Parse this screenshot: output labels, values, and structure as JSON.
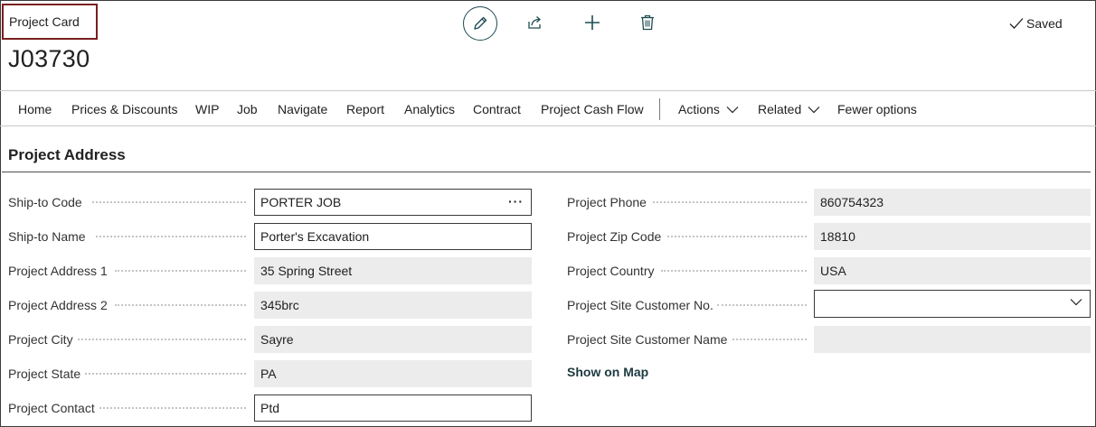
{
  "page": {
    "title": "Project Card",
    "record_no": "J03730",
    "status": "Saved"
  },
  "toolbar": {
    "edit_icon": "pencil-icon",
    "share_icon": "share-icon",
    "new_icon": "plus-icon",
    "delete_icon": "trash-icon"
  },
  "action_bar": {
    "items": [
      "Home",
      "Prices & Discounts",
      "WIP",
      "Job",
      "Navigate",
      "Report",
      "Analytics",
      "Contract",
      "Project Cash Flow"
    ],
    "actions": "Actions",
    "related": "Related",
    "fewer_options": "Fewer options"
  },
  "section": {
    "title": "Project Address"
  },
  "fields_left": [
    {
      "label": "Ship-to Code",
      "value": "PORTER JOB",
      "editable": true
    },
    {
      "label": "Ship-to Name",
      "value": "Porter's Excavation",
      "editable": true
    },
    {
      "label": "Project  Address 1",
      "value": "35 Spring Street",
      "editable": false
    },
    {
      "label": "Project  Address 2",
      "value": "345brc",
      "editable": false
    },
    {
      "label": "Project City",
      "value": "Sayre",
      "editable": false
    },
    {
      "label": "Project State",
      "value": "PA",
      "editable": false
    },
    {
      "label": "Project Contact",
      "value": "Ptd",
      "editable": true
    }
  ],
  "fields_right": [
    {
      "label": "Project Phone",
      "value": "860754323",
      "editable": false
    },
    {
      "label": "Project Zip Code",
      "value": "18810",
      "editable": false
    },
    {
      "label": "Project Country",
      "value": "USA",
      "editable": false
    },
    {
      "label": "Project Site Customer No.",
      "value": "",
      "editable": true
    },
    {
      "label": "Project Site Customer Name",
      "value": "",
      "editable": false
    }
  ],
  "links": {
    "show_on_map": "Show on Map"
  },
  "colors": {
    "accent": "#1e4b53",
    "title_border": "#7a1f1f",
    "readonly_bg": "#ececec"
  }
}
